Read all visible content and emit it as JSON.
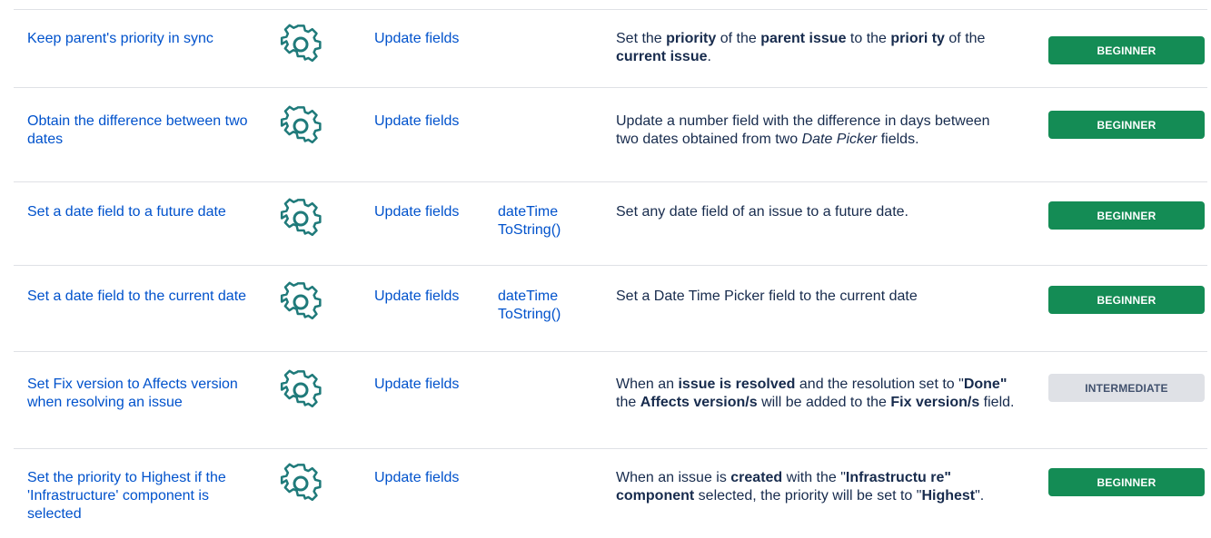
{
  "icon": "gear-icon",
  "colors": {
    "link": "#0052cc",
    "beginner": "#148c55",
    "intermediate": "#dfe1e6",
    "icon": "#1f7a7a"
  },
  "rows": [
    {
      "name": "Keep parent's priority in sync",
      "action": "Update fields",
      "func": "",
      "desc_html": "Set the <b>priority</b> of the <b>parent issue</b> to the <b>priori ty</b> of the <b>current issue</b>.",
      "level": "BEGINNER"
    },
    {
      "name": "Obtain the difference between two dates",
      "action": "Update fields",
      "func": "",
      "desc_html": "Update a number field with the difference in days between two dates obtained from two <i>Date Picker</i> fields.",
      "level": "BEGINNER"
    },
    {
      "name": "Set a date field to a future date",
      "action": "Update fields",
      "func": "dateTime ToString()",
      "desc_html": "Set any date field of an issue to a future date.",
      "level": "BEGINNER"
    },
    {
      "name": "Set a date field to the current date",
      "action": "Update fields",
      "func": "dateTime ToString()",
      "desc_html": "Set a Date Time Picker field to the current date",
      "level": "BEGINNER"
    },
    {
      "name": "Set Fix version to Affects version when resolving an issue",
      "action": "Update fields",
      "func": "",
      "desc_html": "When an <b>issue is resolved</b> and the resolution set to \"<b>Done\"</b> the <b>Affects version/s</b> will be added to the <b>Fix version/s</b> field.",
      "level": "INTERMEDIATE"
    },
    {
      "name": "Set the priority to Highest if the 'Infrastructure' component is selected",
      "action": "Update fields",
      "func": "",
      "desc_html": "When an issue is <b>created</b> with the \"<b>Infrastructu re\" component</b> selected, the priority will be set to \"<b>Highest</b>\".",
      "level": "BEGINNER"
    }
  ]
}
